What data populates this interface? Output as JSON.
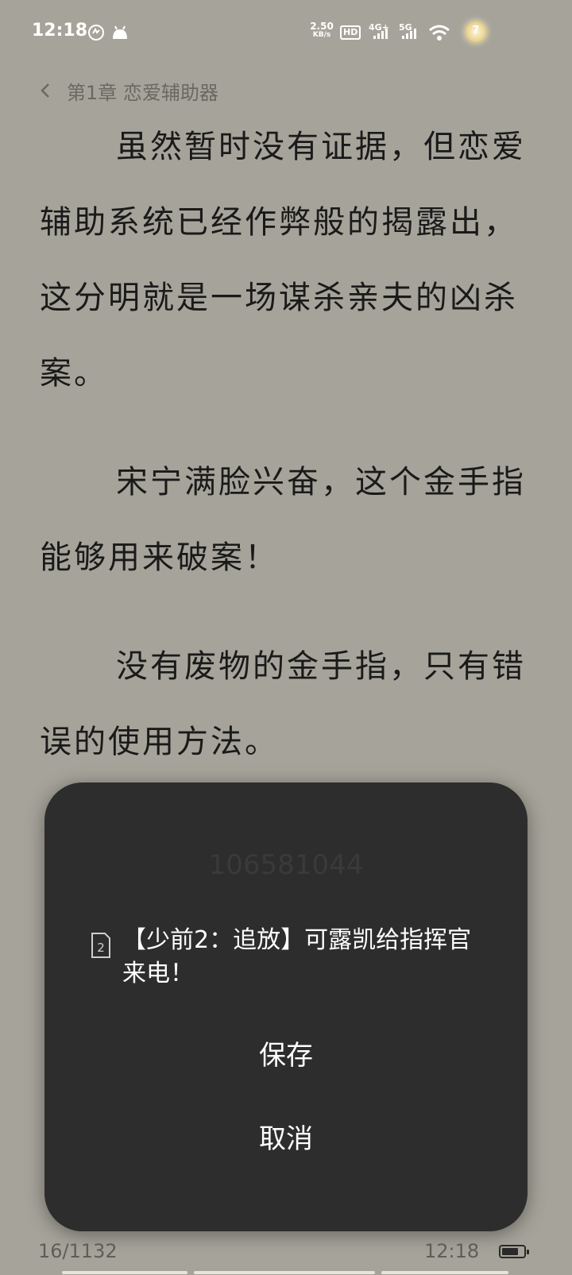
{
  "status_bar": {
    "time": "12:18",
    "speed_value": "2.50",
    "speed_unit": "KB/s",
    "hd_label": "HD",
    "net_4g": "4G+",
    "net_5g": "5G",
    "badge_text": "7"
  },
  "header": {
    "chapter_title": "第1章 恋爱辅助器"
  },
  "reader": {
    "paragraphs": [
      "虽然暂时没有证据，但恋爱辅助系统已经作弊般的揭露出，这分明就是一场谋杀亲夫的凶杀案。",
      "宋宁满脸兴奋，这个金手指能够用来破案！",
      "没有废物的金手指，只有错误的使用方法。"
    ]
  },
  "dialog": {
    "faint_number": "106581044",
    "message": "【少前2：追放】可露凯给指挥官来电！",
    "save_label": "保存",
    "cancel_label": "取消"
  },
  "footer": {
    "page": "16/1132",
    "time": "12:18",
    "battery_level": 0.75
  }
}
